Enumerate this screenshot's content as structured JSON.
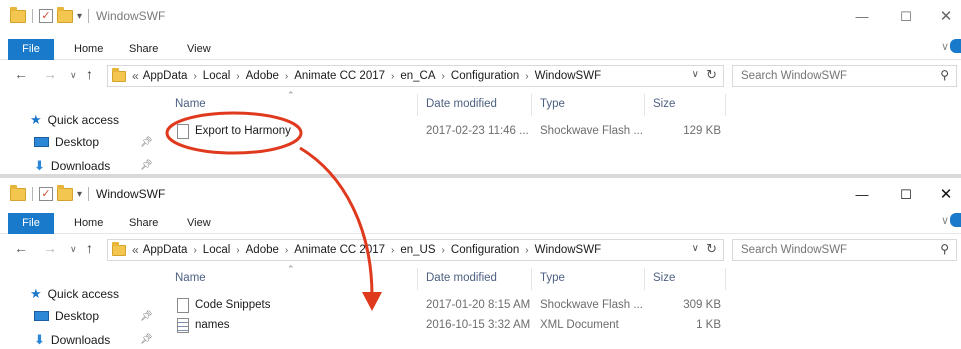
{
  "windows": [
    {
      "title": "WindowSWF",
      "tabs": {
        "file": "File",
        "home": "Home",
        "share": "Share",
        "view": "View"
      },
      "window_controls": {
        "minimize": "—",
        "maximize": "☐",
        "close": "✕"
      },
      "address": {
        "overflow": "«",
        "crumbs": [
          "AppData",
          "Local",
          "Adobe",
          "Animate CC 2017",
          "en_CA",
          "Configuration",
          "WindowSWF"
        ]
      },
      "search_placeholder": "Search WindowSWF",
      "nav": {
        "quick_access": "Quick access",
        "desktop": "Desktop",
        "downloads": "Downloads"
      },
      "columns": {
        "name": "Name",
        "date": "Date modified",
        "type": "Type",
        "size": "Size"
      },
      "files": [
        {
          "name": "Export to Harmony",
          "date": "2017-02-23 11:46 ...",
          "type": "Shockwave Flash ...",
          "size": "129 KB",
          "icon": "file-icon"
        }
      ]
    },
    {
      "title": "WindowSWF",
      "tabs": {
        "file": "File",
        "home": "Home",
        "share": "Share",
        "view": "View"
      },
      "window_controls": {
        "minimize": "—",
        "maximize": "☐",
        "close": "✕"
      },
      "address": {
        "overflow": "«",
        "crumbs": [
          "AppData",
          "Local",
          "Adobe",
          "Animate CC 2017",
          "en_US",
          "Configuration",
          "WindowSWF"
        ]
      },
      "search_placeholder": "Search WindowSWF",
      "nav": {
        "quick_access": "Quick access",
        "desktop": "Desktop",
        "downloads": "Downloads"
      },
      "columns": {
        "name": "Name",
        "date": "Date modified",
        "type": "Type",
        "size": "Size"
      },
      "files": [
        {
          "name": "Code Snippets",
          "date": "2017-01-20 8:15 AM",
          "type": "Shockwave Flash ...",
          "size": "309 KB",
          "icon": "file-icon"
        },
        {
          "name": "names",
          "date": "2016-10-15 3:32 AM",
          "type": "XML Document",
          "size": "1 KB",
          "icon": "xml-file-icon"
        }
      ]
    }
  ],
  "annotation": {
    "highlight_color": "#e03a1e"
  }
}
